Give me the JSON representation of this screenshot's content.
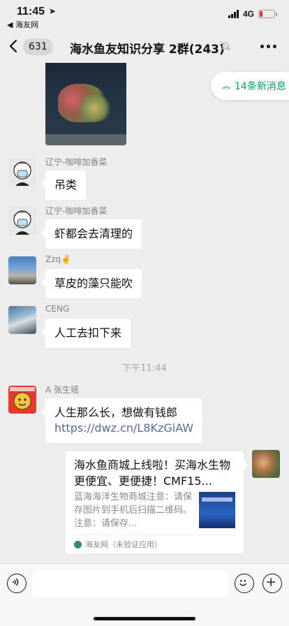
{
  "status_bar": {
    "time": "11:45",
    "back_app": "◀ 海友网",
    "network": "4G"
  },
  "nav": {
    "unread_count": "631",
    "title": "海水鱼友知识分享 2群(243)"
  },
  "new_messages_label": "14条新消息",
  "messages": [
    {
      "sender": "辽宁-咖啡加香菜",
      "text": "吊类"
    },
    {
      "sender": "辽宁-咖啡加香菜",
      "text": "虾都会去清理的"
    },
    {
      "sender": "Zzq✌️",
      "text": "草皮的藻只能吹"
    },
    {
      "sender": "CENG",
      "text": "人工去扣下来"
    },
    {
      "sender": "A 张生瑶",
      "text": "人生那么长，想做有钱郎",
      "link": "https://dwz.cn/L8KzGiAW"
    }
  ],
  "time_separator": "下午11:44",
  "link_card": {
    "title": "海水鱼商城上线啦！买海水生物更便宜、更便捷！CMF15...",
    "description": "蓝海海洋生物商城注意：请保存图片到手机后扫描二维码。注意：请保存...",
    "source": "海友网（未验证应用）"
  },
  "input": {
    "placeholder": ""
  },
  "colors": {
    "accent_green": "#07a05a",
    "link_blue": "#576b95",
    "chat_bg": "#ededed"
  }
}
